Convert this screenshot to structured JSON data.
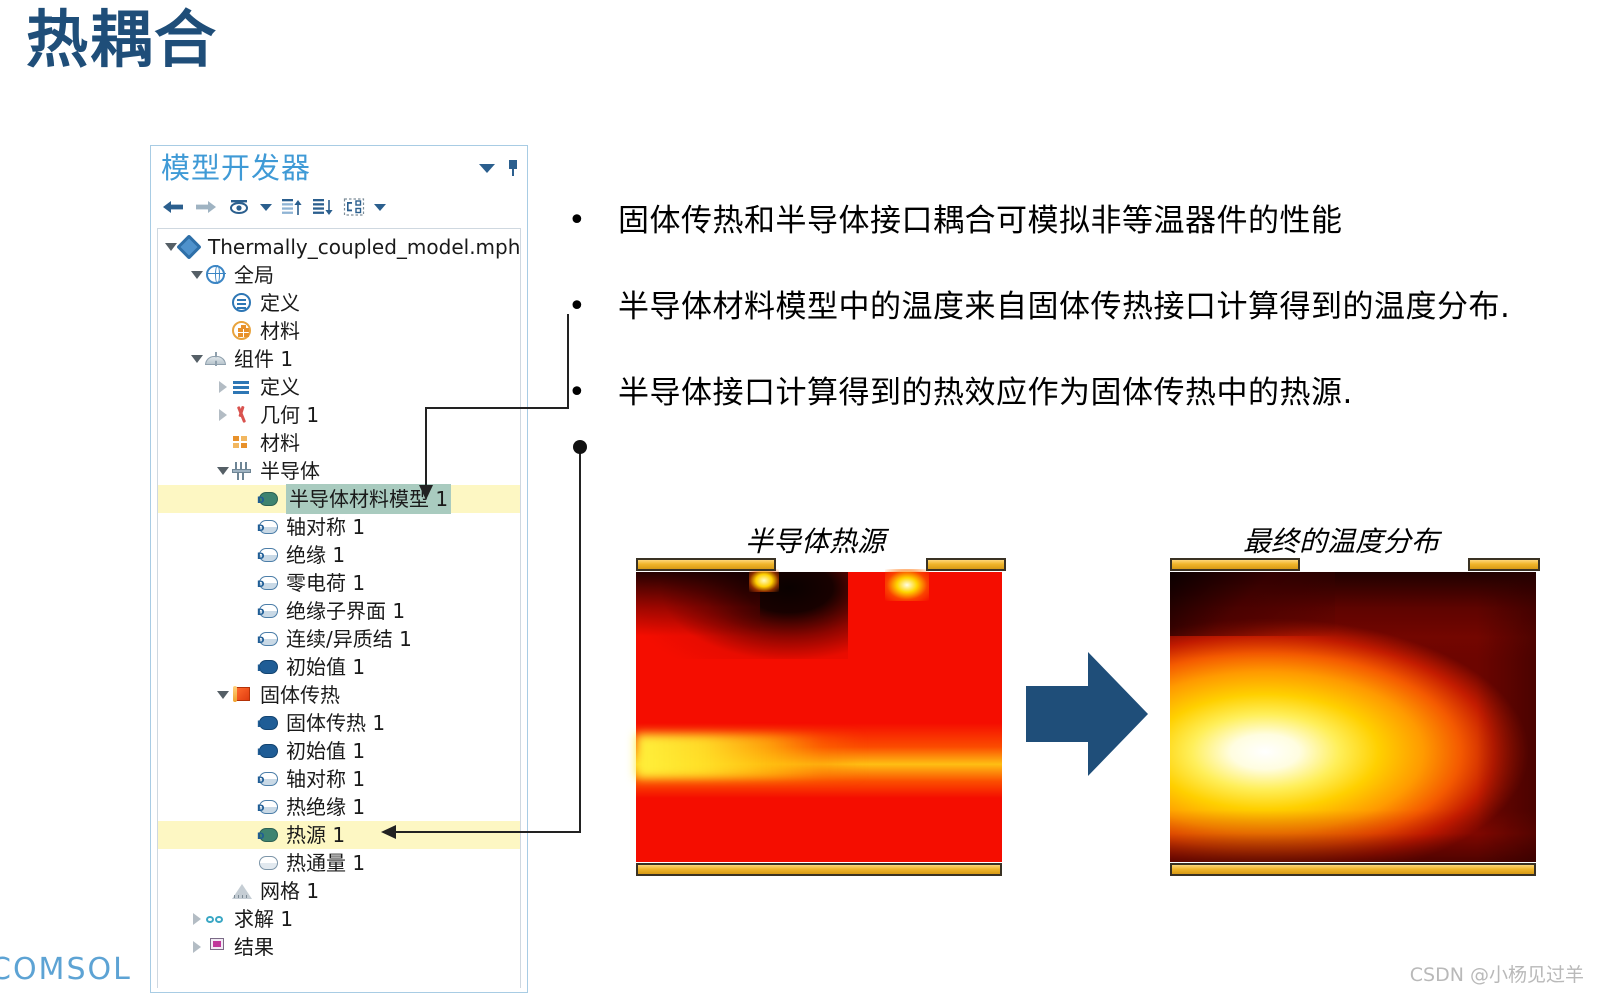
{
  "slide": {
    "title": "热耦合",
    "title_color": "#1f4e79"
  },
  "model_builder": {
    "panel_title": "模型开发器",
    "header_icons": [
      "chevron-down-icon",
      "pin-icon"
    ],
    "toolbar": [
      {
        "name": "back-arrow-icon",
        "label": "←"
      },
      {
        "name": "forward-arrow-icon",
        "label": "→"
      },
      {
        "name": "show-eye-icon",
        "label": "👁"
      },
      {
        "name": "show-dropdown-caret-icon",
        "label": "▾"
      },
      {
        "name": "collapse-up-icon",
        "label": "≡↑"
      },
      {
        "name": "expand-down-icon",
        "label": "≡↓"
      },
      {
        "name": "node-layout-icon",
        "label": "⊞"
      },
      {
        "name": "layout-dropdown-caret-icon",
        "label": "▾"
      }
    ],
    "tree": [
      {
        "label": "Thermally_coupled_model.mph",
        "indent": 0,
        "twist": "open",
        "icon": "model-file-icon",
        "state": "normal"
      },
      {
        "label": "全局",
        "indent": 1,
        "twist": "open",
        "icon": "global-globe-icon",
        "state": "normal"
      },
      {
        "label": "定义",
        "indent": 2,
        "twist": "none",
        "icon": "global-definitions-icon",
        "state": "normal"
      },
      {
        "label": "材料",
        "indent": 2,
        "twist": "none",
        "icon": "global-materials-icon",
        "state": "normal"
      },
      {
        "label": "组件 1",
        "indent": 1,
        "twist": "open",
        "icon": "component-icon",
        "state": "normal"
      },
      {
        "label": "定义",
        "indent": 2,
        "twist": "closed",
        "icon": "definitions-icon",
        "state": "normal"
      },
      {
        "label": "几何 1",
        "indent": 2,
        "twist": "closed",
        "icon": "geometry-icon",
        "state": "normal"
      },
      {
        "label": "材料",
        "indent": 2,
        "twist": "none",
        "icon": "materials-icon",
        "state": "normal"
      },
      {
        "label": "半导体",
        "indent": 2,
        "twist": "open",
        "icon": "semiconductor-icon",
        "state": "normal"
      },
      {
        "label": "半导体材料模型 1",
        "indent": 3,
        "twist": "none",
        "icon": "bc-green-icon",
        "state": "selected"
      },
      {
        "label": "轴对称 1",
        "indent": 3,
        "twist": "none",
        "icon": "bc-outline-icon",
        "state": "normal"
      },
      {
        "label": "绝缘 1",
        "indent": 3,
        "twist": "none",
        "icon": "bc-outline-icon",
        "state": "normal"
      },
      {
        "label": "零电荷 1",
        "indent": 3,
        "twist": "none",
        "icon": "bc-outline-icon",
        "state": "normal"
      },
      {
        "label": "绝缘子界面 1",
        "indent": 3,
        "twist": "none",
        "icon": "bc-outline-icon",
        "state": "normal"
      },
      {
        "label": "连续/异质结 1",
        "indent": 3,
        "twist": "none",
        "icon": "bc-outline-icon",
        "state": "normal"
      },
      {
        "label": "初始值 1",
        "indent": 3,
        "twist": "none",
        "icon": "bc-filled-icon",
        "state": "normal"
      },
      {
        "label": "固体传热",
        "indent": 2,
        "twist": "open",
        "icon": "heat-transfer-icon",
        "state": "normal"
      },
      {
        "label": "固体传热 1",
        "indent": 3,
        "twist": "none",
        "icon": "bc-filled-icon",
        "state": "normal"
      },
      {
        "label": "初始值 1",
        "indent": 3,
        "twist": "none",
        "icon": "bc-filled-icon",
        "state": "normal"
      },
      {
        "label": "轴对称 1",
        "indent": 3,
        "twist": "none",
        "icon": "bc-outline-icon",
        "state": "normal"
      },
      {
        "label": "热绝缘 1",
        "indent": 3,
        "twist": "none",
        "icon": "bc-outline-icon",
        "state": "normal"
      },
      {
        "label": "热源 1",
        "indent": 3,
        "twist": "none",
        "icon": "bc-green-icon",
        "state": "highlighted"
      },
      {
        "label": "热通量 1",
        "indent": 3,
        "twist": "none",
        "icon": "bc-plain-icon",
        "state": "normal"
      },
      {
        "label": "网格 1",
        "indent": 2,
        "twist": "none",
        "icon": "mesh-icon",
        "state": "normal"
      },
      {
        "label": "求解 1",
        "indent": 1,
        "twist": "closed",
        "icon": "solver-icon",
        "state": "normal"
      },
      {
        "label": "结果",
        "indent": 1,
        "twist": "closed",
        "icon": "results-icon",
        "state": "normal"
      }
    ]
  },
  "bullets": [
    {
      "marker": "•",
      "text": "固体传热和半导体接口耦合可模拟非等温器件的性能"
    },
    {
      "marker": "•",
      "text": "半导体材料模型中的温度来自固体传热接口计算得到的温度分布."
    },
    {
      "marker": "•",
      "text": "半导体接口计算得到的热效应作为固体传热中的热源."
    }
  ],
  "figures": {
    "left": {
      "caption": "半导体热源"
    },
    "right": {
      "caption": "最终的温度分布"
    },
    "arrow": {
      "name": "right-arrow-shape",
      "color": "#1f4e79"
    }
  },
  "footer": {
    "logo": "COMSOL",
    "watermark": "CSDN @小杨见过羊"
  }
}
